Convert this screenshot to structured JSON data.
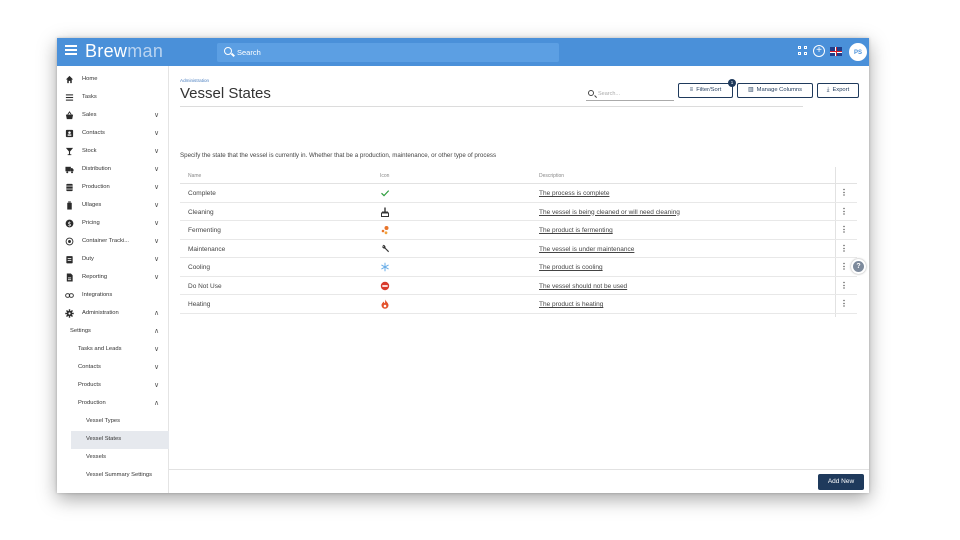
{
  "app": {
    "logo_part1": "Brew",
    "logo_part2": "man",
    "search_placeholder": "Search",
    "user_initials": "PS",
    "brand_color": "#4a90d9",
    "accent_color": "#1f3a5c"
  },
  "sidebar": {
    "items": [
      {
        "label": "Home",
        "icon": "home-icon"
      },
      {
        "label": "Tasks",
        "icon": "list-icon"
      },
      {
        "label": "Sales",
        "icon": "basket-icon"
      },
      {
        "label": "Contacts",
        "icon": "contact-card-icon"
      },
      {
        "label": "Stock",
        "icon": "glass-icon"
      },
      {
        "label": "Distribution",
        "icon": "truck-icon"
      },
      {
        "label": "Production",
        "icon": "keg-icon"
      },
      {
        "label": "Ullages",
        "icon": "bottle-icon"
      },
      {
        "label": "Pricing",
        "icon": "dollar-icon"
      },
      {
        "label": "Container Tracki...",
        "icon": "target-icon"
      },
      {
        "label": "Duty",
        "icon": "clipboard-icon"
      },
      {
        "label": "Reporting",
        "icon": "report-icon"
      },
      {
        "label": "Integrations",
        "icon": "link-icon"
      },
      {
        "label": "Administration",
        "icon": "gear-icon"
      }
    ],
    "settings_label": "Settings",
    "sub_items": [
      {
        "label": "Tasks and Leads"
      },
      {
        "label": "Contacts"
      },
      {
        "label": "Products"
      },
      {
        "label": "Production"
      }
    ],
    "production_items": [
      {
        "label": "Vessel Types"
      },
      {
        "label": "Vessel States"
      },
      {
        "label": "Vessels"
      },
      {
        "label": "Vessel Summary Settings"
      }
    ]
  },
  "main": {
    "breadcrumb": "Administration",
    "title": "Vessel States",
    "search_placeholder": "Search...",
    "filter_label": "Filter/Sort",
    "filter_badge": "1",
    "columns_label": "Manage Columns",
    "export_label": "Export",
    "description": "Specify the state that the vessel is currently in. Whether that be a production, maintenance, or other type of process",
    "columns": [
      "Name",
      "Icon",
      "Description"
    ],
    "rows": [
      {
        "name": "Complete",
        "icon": "check-icon",
        "icon_color": "#2e9e3e",
        "description": "The process is complete"
      },
      {
        "name": "Cleaning",
        "icon": "broom-icon",
        "icon_color": "#333333",
        "description": "The vessel is being cleaned or will need cleaning"
      },
      {
        "name": "Fermenting",
        "icon": "bubbles-icon",
        "icon_color": "#e8742a",
        "description": "The product is fermenting"
      },
      {
        "name": "Maintenance",
        "icon": "wrench-icon",
        "icon_color": "#333333",
        "description": "The vessel is under maintenance"
      },
      {
        "name": "Cooling",
        "icon": "snowflake-icon",
        "icon_color": "#6aaee8",
        "description": "The product is cooling"
      },
      {
        "name": "Do Not Use",
        "icon": "no-entry-icon",
        "icon_color": "#d93a2b",
        "description": "The vessel should not be used"
      },
      {
        "name": "Heating",
        "icon": "flame-icon",
        "icon_color": "#e4512a",
        "description": "The product is heating"
      }
    ],
    "add_label": "Add New"
  }
}
